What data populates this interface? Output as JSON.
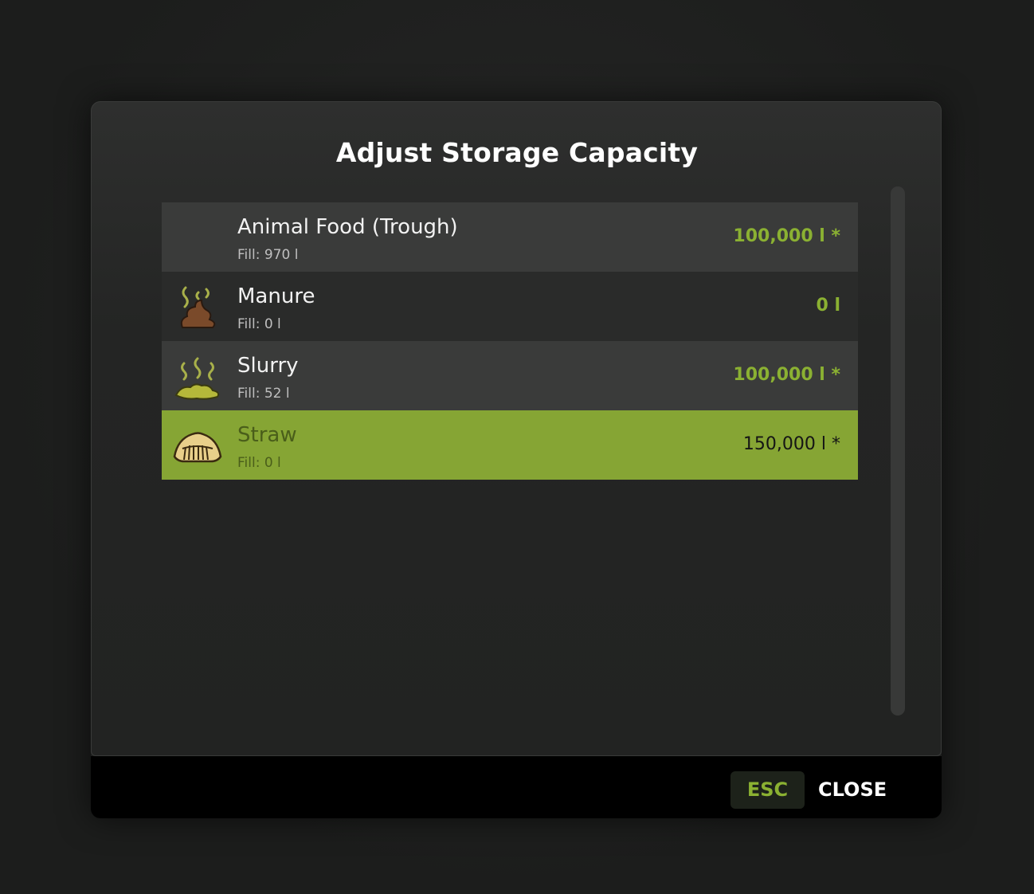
{
  "dialog": {
    "title": "Adjust Storage Capacity"
  },
  "items": [
    {
      "name": "Animal Food (Trough)",
      "fill": "Fill: 970 l",
      "capacity": "100,000 l *",
      "icon": "none"
    },
    {
      "name": "Manure",
      "fill": "Fill: 0 l",
      "capacity": "0 l",
      "icon": "manure-icon"
    },
    {
      "name": "Slurry",
      "fill": "Fill: 52 l",
      "capacity": "100,000 l *",
      "icon": "slurry-icon"
    },
    {
      "name": "Straw",
      "fill": "Fill: 0 l",
      "capacity": "150,000 l *",
      "icon": "straw-icon",
      "selected": true
    }
  ],
  "footer": {
    "esc_key": "ESC",
    "close_label": "CLOSE"
  },
  "colors": {
    "accent": "#86a534",
    "accent_text": "#8bb132"
  }
}
